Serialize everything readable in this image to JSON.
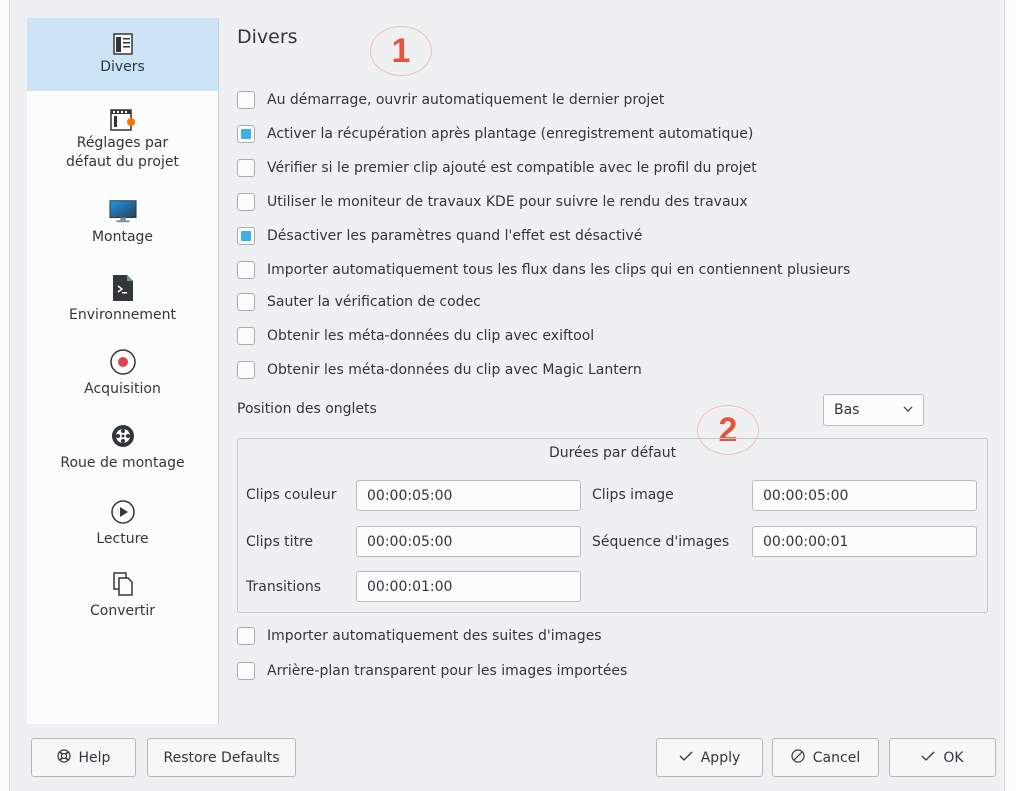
{
  "sidebar": {
    "items": [
      {
        "label": "Divers",
        "icon": "document-list-icon",
        "active": true
      },
      {
        "label": "Réglages par\ndéfaut du projet",
        "icon": "film-settings-icon"
      },
      {
        "label": "Montage",
        "icon": "monitor-icon"
      },
      {
        "label": "Environnement",
        "icon": "terminal-icon"
      },
      {
        "label": "Acquisition",
        "icon": "record-icon"
      },
      {
        "label": "Roue de montage",
        "icon": "jog-wheel-icon"
      },
      {
        "label": "Lecture",
        "icon": "play-icon"
      },
      {
        "label": "Convertir",
        "icon": "convert-icon"
      }
    ]
  },
  "main": {
    "title": "Divers",
    "badges": [
      "1",
      "2"
    ],
    "checkboxes": [
      {
        "label": "Au démarrage, ouvrir automatiquement le dernier projet",
        "checked": false
      },
      {
        "label": "Activer la récupération après plantage (enregistrement automatique)",
        "checked": true
      },
      {
        "label": "Vérifier si le premier clip ajouté est compatible avec le profil du projet",
        "checked": false
      },
      {
        "label": "Utiliser le moniteur de travaux KDE pour suivre le rendu des travaux",
        "checked": false
      },
      {
        "label": "Désactiver les paramètres quand l'effet est désactivé",
        "checked": true
      },
      {
        "label": "Importer automatiquement tous les flux dans les clips qui en contiennent plusieurs",
        "checked": false
      },
      {
        "label": "Sauter la vérification de codec",
        "checked": false
      },
      {
        "label": "Obtenir les méta-données du clip avec exiftool",
        "checked": false
      },
      {
        "label": "Obtenir les méta-données du clip avec Magic Lantern",
        "checked": false
      }
    ],
    "tab_position": {
      "label": "Position des onglets",
      "value": "Bas"
    },
    "durations": {
      "title": "Durées par défaut",
      "fields": {
        "color_clips": {
          "label": "Clips couleur",
          "value": "00:00:05:00"
        },
        "image_clips": {
          "label": "Clips image",
          "value": "00:00:05:00"
        },
        "title_clips": {
          "label": "Clips titre",
          "value": "00:00:05:00"
        },
        "image_sequence": {
          "label": "Séquence d'images",
          "value": "00:00:00:01"
        },
        "transitions": {
          "label": "Transitions",
          "value": "00:00:01:00"
        }
      }
    },
    "bottom_checkboxes": [
      {
        "label": "Importer automatiquement des suites d'images",
        "checked": false
      },
      {
        "label": "Arrière-plan transparent pour les images importées",
        "checked": false
      }
    ]
  },
  "buttons": {
    "help": "Help",
    "restore": "Restore Defaults",
    "apply": "Apply",
    "cancel": "Cancel",
    "ok": "OK"
  },
  "colors": {
    "accent": "#3daee9",
    "selection": "#cde4f7",
    "badge": "#e5533d"
  }
}
